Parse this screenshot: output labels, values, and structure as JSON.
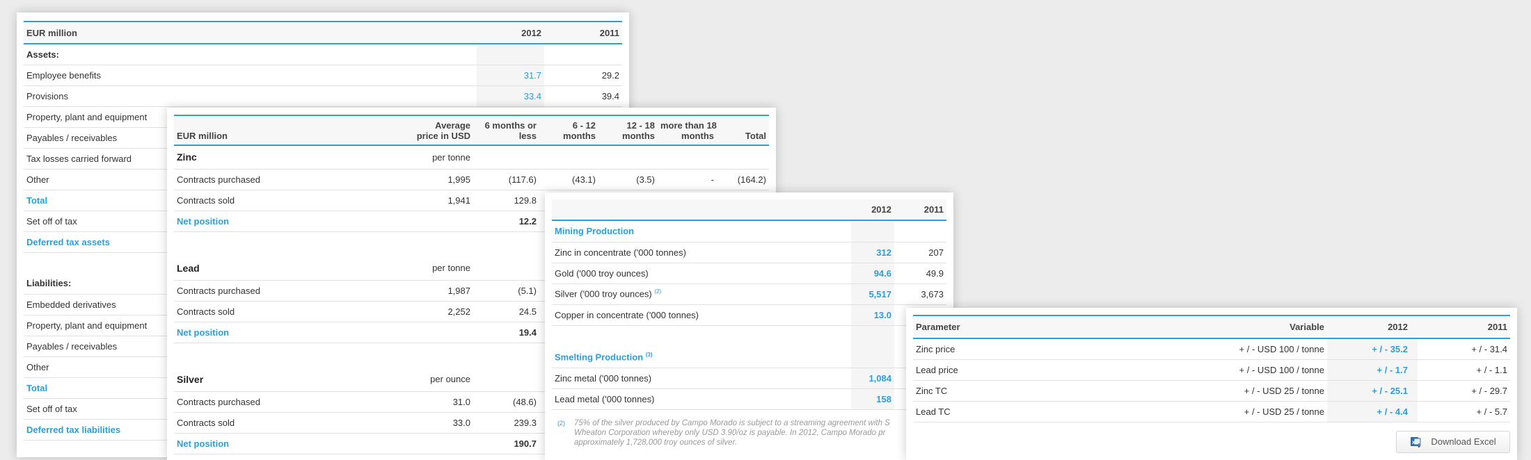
{
  "deferred_tax": {
    "header": {
      "label": "EUR million",
      "y2012": "2012",
      "y2011": "2011"
    },
    "assets_title": "Assets:",
    "assets": [
      {
        "label": "Employee benefits",
        "v2012": "31.7",
        "v2011": "29.2"
      },
      {
        "label": "Provisions",
        "v2012": "33.4",
        "v2011": "39.4"
      },
      {
        "label": "Property, plant and equipment",
        "v2012": "",
        "v2011": ""
      },
      {
        "label": "Payables / receivables",
        "v2012": "",
        "v2011": ""
      },
      {
        "label": "Tax losses carried forward",
        "v2012": "",
        "v2011": ""
      },
      {
        "label": "Other",
        "v2012": "",
        "v2011": ""
      }
    ],
    "assets_total": "Total",
    "assets_setoff": "Set off of tax",
    "assets_deferred": "Deferred tax assets",
    "liabilities_title": "Liabilities:",
    "liabilities": [
      {
        "label": "Embedded derivatives"
      },
      {
        "label": "Property, plant and equipment"
      },
      {
        "label": "Payables / receivables"
      },
      {
        "label": "Other"
      }
    ],
    "liabilities_total": "Total",
    "liabilities_setoff": "Set off of tax",
    "liabilities_deferred": "Deferred tax liabilities"
  },
  "contracts": {
    "header": {
      "label": "EUR million",
      "avg_price_1": "Average",
      "avg_price_2": "price in USD",
      "m6_1": "6 months or",
      "m6_2": "less",
      "m612_1": "6 - 12",
      "m612_2": "months",
      "m1218_1": "12 - 18",
      "m1218_2": "months",
      "m18_1": "more than 18",
      "m18_2": "months",
      "total": "Total"
    },
    "zinc": {
      "title": "Zinc",
      "unit": "per tonne",
      "purchased": {
        "label": "Contracts purchased",
        "price": "1,995",
        "m6": "(117.6)",
        "m612": "(43.1)",
        "m1218": "(3.5)",
        "m18": "-",
        "total": "(164.2)"
      },
      "sold": {
        "label": "Contracts sold",
        "price": "1,941",
        "m6": "129.8"
      },
      "net": {
        "label": "Net position",
        "m6": "12.2"
      }
    },
    "lead": {
      "title": "Lead",
      "unit": "per tonne",
      "purchased": {
        "label": "Contracts purchased",
        "price": "1,987",
        "m6": "(5.1)"
      },
      "sold": {
        "label": "Contracts sold",
        "price": "2,252",
        "m6": "24.5"
      },
      "net": {
        "label": "Net position",
        "m6": "19.4"
      }
    },
    "silver": {
      "title": "Silver",
      "unit": "per ounce",
      "purchased": {
        "label": "Contracts purchased",
        "price": "31.0",
        "m6": "(48.6)"
      },
      "sold": {
        "label": "Contracts sold",
        "price": "33.0",
        "m6": "239.3"
      },
      "net": {
        "label": "Net position",
        "m6": "190.7"
      }
    }
  },
  "production": {
    "header": {
      "y2012": "2012",
      "y2011": "2011"
    },
    "mining_title": "Mining Production",
    "mining": [
      {
        "label": "Zinc in concentrate ('000 tonnes)",
        "v2012": "312",
        "v2011": "207"
      },
      {
        "label": "Gold ('000 troy ounces)",
        "v2012": "94.6",
        "v2011": "49.9"
      },
      {
        "label": "Silver ('000 troy ounces)",
        "sup": "(2)",
        "v2012": "5,517",
        "v2011": "3,673"
      },
      {
        "label": "Copper in concentrate ('000 tonnes)",
        "v2012": "13.0",
        "v2011": ""
      }
    ],
    "smelting_title": "Smelting Production",
    "smelting_sup": "(3)",
    "smelting": [
      {
        "label": "Zinc metal ('000 tonnes)",
        "v2012": "1,084"
      },
      {
        "label": "Lead metal ('000 tonnes)",
        "v2012": "158"
      }
    ],
    "footnote_mark": "(2)",
    "footnote_1": "75% of the silver produced by Campo Morado is subject to a streaming agreement with S",
    "footnote_2": "Wheaton Corporation whereby only USD 3.90/oz is payable. In 2012, Campo Morado pr",
    "footnote_3": "approximately 1,728,000 troy ounces of silver."
  },
  "sensitivity": {
    "header": {
      "parameter": "Parameter",
      "variable": "Variable",
      "y2012": "2012",
      "y2011": "2011"
    },
    "rows": [
      {
        "parameter": "Zinc price",
        "variable": "+ / - USD 100 / tonne",
        "v2012": "+ / - 35.2",
        "v2011": "+ / - 31.4"
      },
      {
        "parameter": "Lead price",
        "variable": "+ / - USD 100 / tonne",
        "v2012": "+ / - 1.7",
        "v2011": "+ / - 1.1"
      },
      {
        "parameter": "Zinc TC",
        "variable": "+ / - USD 25 / tonne",
        "v2012": "+ / - 25.1",
        "v2011": "+ / - 29.7"
      },
      {
        "parameter": "Lead TC",
        "variable": "+ / - USD 25 / tonne",
        "v2012": "+ / - 4.4",
        "v2011": "+ / - 5.7"
      }
    ],
    "download_label": "Download Excel"
  },
  "colors": {
    "accent": "#2e9ed6",
    "excel_icon": "#2a6fb0"
  }
}
